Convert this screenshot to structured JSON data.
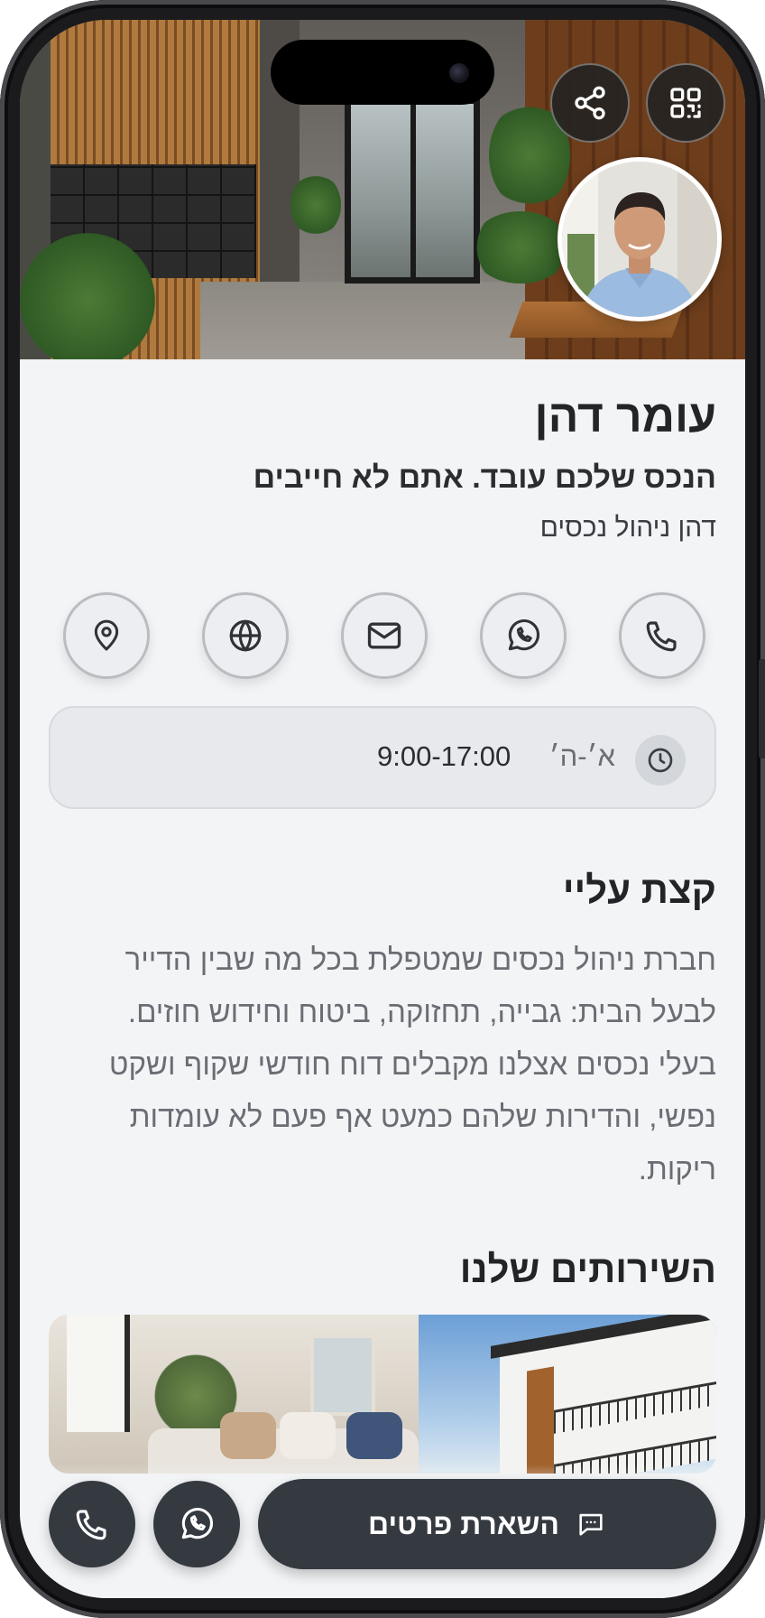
{
  "profile": {
    "name": "עומר דהן",
    "tagline": "הנכס שלכם עובד. אתם לא חייבים",
    "company": "דהן ניהול נכסים"
  },
  "header": {
    "icons": [
      "share-icon",
      "qr-code-icon"
    ]
  },
  "contact_actions": [
    {
      "name": "location",
      "icon": "map-pin-icon"
    },
    {
      "name": "website",
      "icon": "globe-icon"
    },
    {
      "name": "email",
      "icon": "mail-icon"
    },
    {
      "name": "whatsapp",
      "icon": "whatsapp-icon"
    },
    {
      "name": "phone",
      "icon": "phone-icon"
    }
  ],
  "hours": {
    "days": "א׳-ה׳",
    "time": "9:00-17:00"
  },
  "about": {
    "title": "קצת עליי",
    "text": "חברת ניהול נכסים שמטפלת בכל מה שבין הדייר לבעל הבית: גבייה, תחזוקה, ביטוח וחידוש חוזים. בעלי נכסים אצלנו מקבלים דוח חודשי שקוף ושקט נפשי, והדירות שלהם כמעט אף פעם לא עומדות ריקות."
  },
  "services": {
    "title": "השירותים שלנו"
  },
  "bottom_bar": {
    "lead_button_label": "השארת פרטים"
  },
  "colors": {
    "background": "#f2f4f6",
    "dark_button": "#353a41",
    "text_primary": "#222427",
    "text_muted": "#6a6d73"
  }
}
